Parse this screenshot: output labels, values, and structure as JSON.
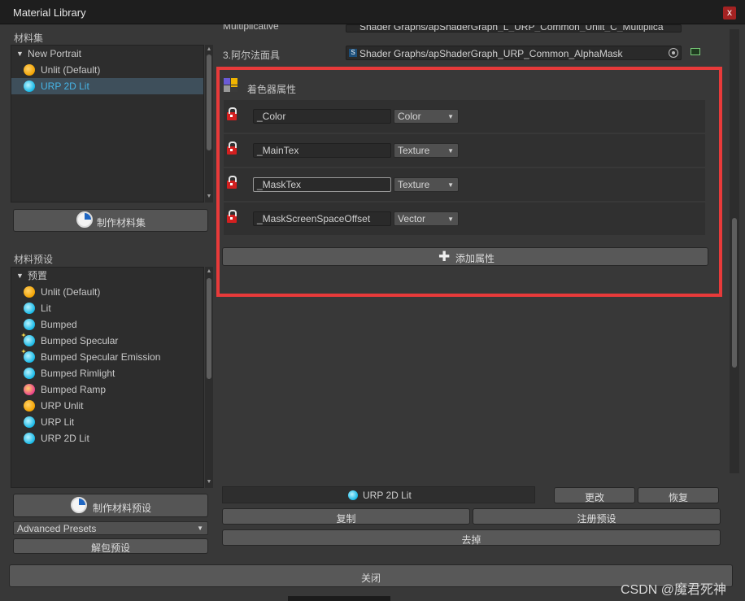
{
  "window": {
    "title": "Material Library",
    "close_glyph": "x"
  },
  "collections": {
    "label": "材料集",
    "items": [
      {
        "label": "New Portrait",
        "kind": "group"
      },
      {
        "label": "Unlit (Default)",
        "icon": "orange-sphere-icon"
      },
      {
        "label": "URP 2D Lit",
        "icon": "cyan-sphere-icon",
        "selected": true
      }
    ],
    "make_button": "制作材料集"
  },
  "presets": {
    "label": "材料预设",
    "group": "预置",
    "items": [
      {
        "label": "Unlit (Default)",
        "icon": "orange-sphere-icon"
      },
      {
        "label": "Lit",
        "icon": "cyan-sphere-icon"
      },
      {
        "label": "Bumped",
        "icon": "cyan-sphere-icon"
      },
      {
        "label": "Bumped Specular",
        "icon": "cyan-sparkle-sphere-icon"
      },
      {
        "label": "Bumped Specular Emission",
        "icon": "cyan-sparkle-sphere-icon"
      },
      {
        "label": "Bumped Rimlight",
        "icon": "cyan-sphere-icon"
      },
      {
        "label": "Bumped Ramp",
        "icon": "magenta-sphere-icon"
      },
      {
        "label": "URP Unlit",
        "icon": "orange-sphere-icon"
      },
      {
        "label": "URP Lit",
        "icon": "cyan-sphere-icon"
      },
      {
        "label": "URP 2D Lit",
        "icon": "cyan-sphere-icon"
      }
    ],
    "make_button": "制作材料预设",
    "advanced_select": "Advanced Presets",
    "unpack_button": "解包预设"
  },
  "shader_rows": [
    {
      "label": "Multiplicative",
      "value": "Shader Graphs/apShaderGraph_L_URP_Common_Unlit_C_Multiplica"
    },
    {
      "label": "3.阿尔法面具",
      "value": "Shader Graphs/apShaderGraph_URP_Common_AlphaMask"
    }
  ],
  "shader_properties": {
    "header": "着色器属性",
    "rows": [
      {
        "name": "_Color",
        "type": "Color"
      },
      {
        "name": "_MainTex",
        "type": "Texture"
      },
      {
        "name": "_MaskTex",
        "type": "Texture"
      },
      {
        "name": "_MaskScreenSpaceOffset",
        "type": "Vector"
      }
    ],
    "add_button": "添加属性"
  },
  "footer": {
    "current": "URP 2D Lit",
    "change": "更改",
    "restore": "恢复",
    "copy": "复制",
    "register_preset": "注册预设",
    "remove": "去掉",
    "close": "关闭"
  },
  "watermark": "CSDN @魔君死神",
  "colors": {
    "highlight_outline": "#e83a3a",
    "selection": "#2c5d87",
    "accent_text": "#46b4e6"
  }
}
